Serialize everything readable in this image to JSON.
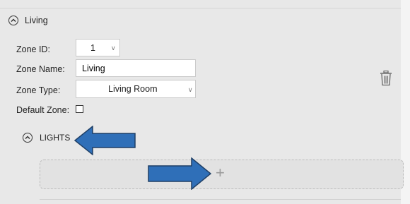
{
  "zone": {
    "header": "Living",
    "id_label": "Zone ID:",
    "id_value": "1",
    "name_label": "Zone Name:",
    "name_value": "Living",
    "type_label": "Zone Type:",
    "type_value": "Living Room",
    "default_label": "Default Zone:",
    "default_checked": false
  },
  "lights": {
    "header": "LIGHTS",
    "add_symbol": "+"
  },
  "icons": {
    "section_collapse": "chevron-up-circle-icon",
    "trash": "trash-icon",
    "dropdown": "chevron-down-icon",
    "annotation_arrows": "arrow-annotation"
  },
  "colors": {
    "arrow_fill": "#2f6fb8",
    "arrow_stroke": "#1f3f66"
  }
}
